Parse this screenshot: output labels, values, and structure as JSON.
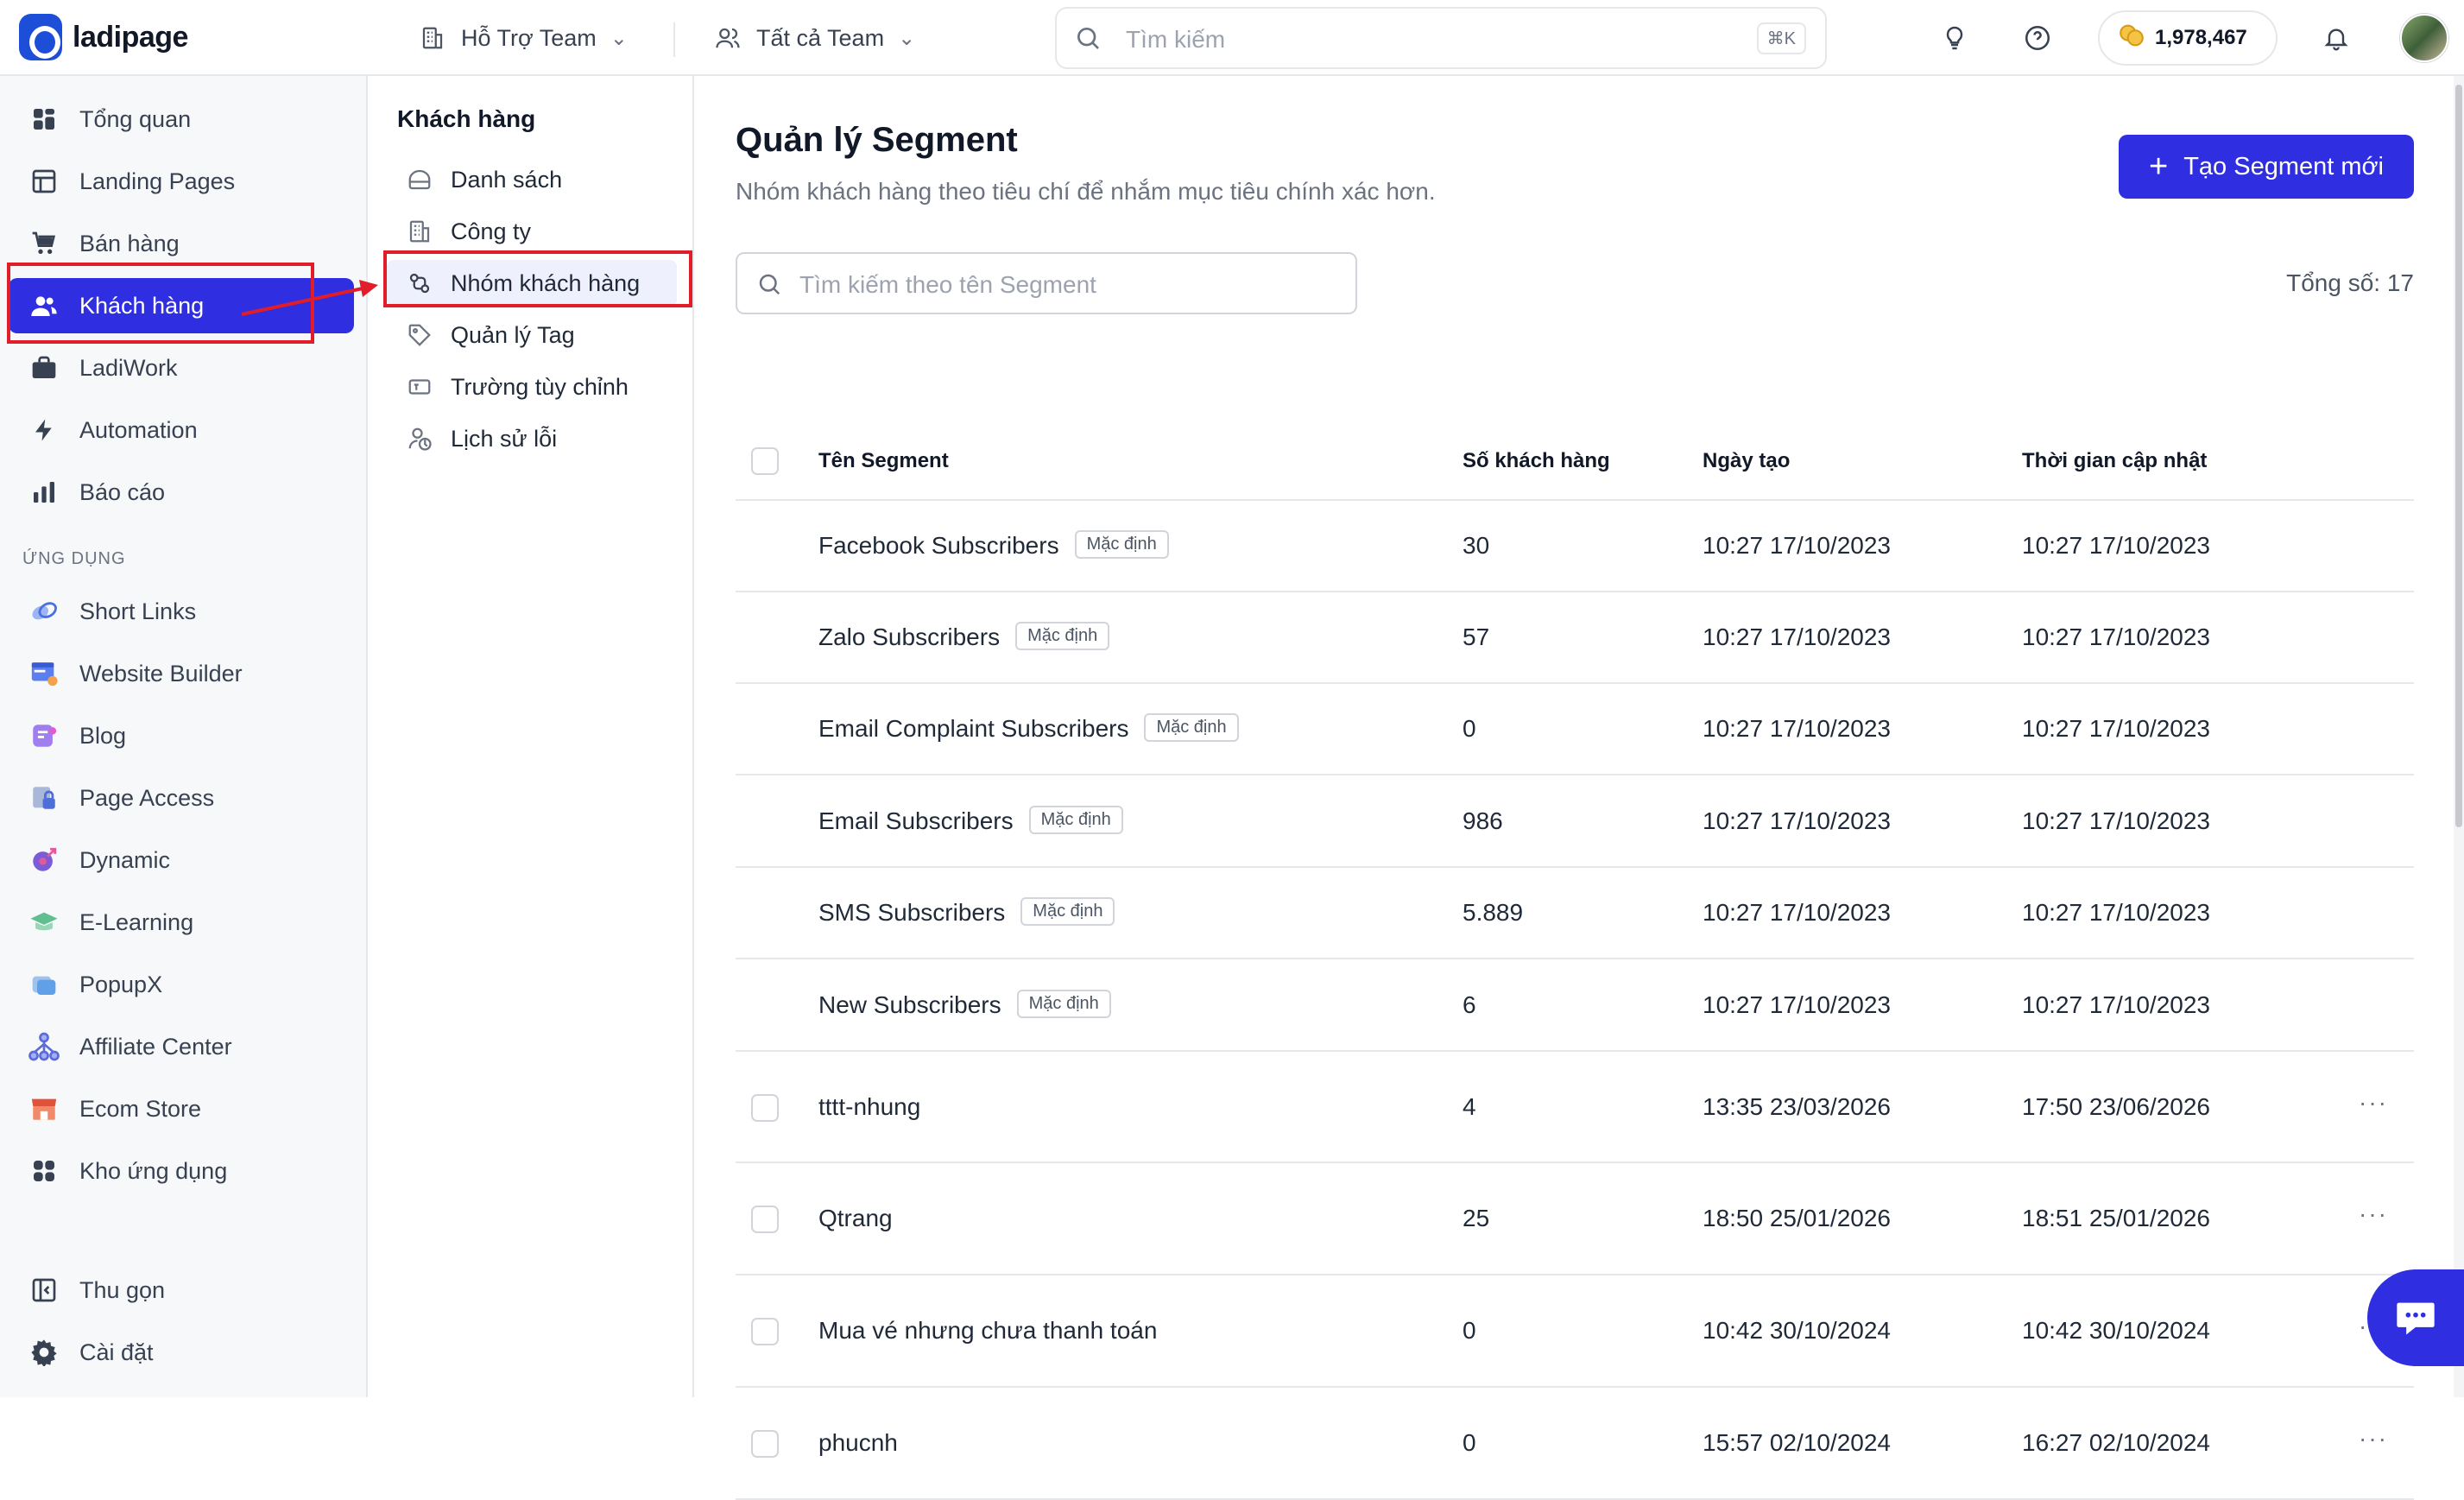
{
  "brand": {
    "name": "ladipage",
    "color": "#2f2ee0"
  },
  "topbar": {
    "team_label": "Hỗ Trợ Team",
    "all_team_label": "Tất cả Team",
    "search_placeholder": "Tìm kiếm",
    "search_shortcut": "⌘K",
    "credits": "1,978,467"
  },
  "sidebar": {
    "items": [
      {
        "label": "Tổng quan",
        "icon": "dashboard-icon"
      },
      {
        "label": "Landing Pages",
        "icon": "layout-icon"
      },
      {
        "label": "Bán hàng",
        "icon": "cart-icon"
      },
      {
        "label": "Khách hàng",
        "icon": "users-icon",
        "active": true
      },
      {
        "label": "LadiWork",
        "icon": "briefcase-icon"
      },
      {
        "label": "Automation",
        "icon": "bolt-icon"
      },
      {
        "label": "Báo cáo",
        "icon": "bar-chart-icon"
      }
    ],
    "apps_section": "ỨNG DỤNG",
    "apps": [
      {
        "label": "Short Links",
        "icon": "link-icon"
      },
      {
        "label": "Website Builder",
        "icon": "website-icon"
      },
      {
        "label": "Blog",
        "icon": "blog-icon"
      },
      {
        "label": "Page Access",
        "icon": "lock-icon"
      },
      {
        "label": "Dynamic",
        "icon": "dynamic-icon"
      },
      {
        "label": "E-Learning",
        "icon": "graduation-cap-icon"
      },
      {
        "label": "PopupX",
        "icon": "popup-icon"
      },
      {
        "label": "Affiliate Center",
        "icon": "affiliate-icon"
      },
      {
        "label": "Ecom Store",
        "icon": "store-icon"
      },
      {
        "label": "Kho ứng dụng",
        "icon": "apps-grid-icon"
      }
    ],
    "collapse_label": "Thu gọn",
    "settings_label": "Cài đặt"
  },
  "subnav": {
    "title": "Khách hàng",
    "items": [
      {
        "label": "Danh sách",
        "icon": "list-icon"
      },
      {
        "label": "Công ty",
        "icon": "building-icon"
      },
      {
        "label": "Nhóm khách hàng",
        "icon": "group-icon",
        "active": true
      },
      {
        "label": "Quản lý Tag",
        "icon": "tag-icon"
      },
      {
        "label": "Trường tùy chỉnh",
        "icon": "custom-field-icon"
      },
      {
        "label": "Lịch sử lỗi",
        "icon": "error-log-icon"
      }
    ]
  },
  "main": {
    "title": "Quản lý Segment",
    "subtitle": "Nhóm khách hàng theo tiêu chí để nhắm mục tiêu chính xác hơn.",
    "create_button": "Tạo Segment mới",
    "search_placeholder": "Tìm kiếm theo tên Segment",
    "total": "Tổng số: 17",
    "columns": [
      "Tên Segment",
      "Số khách hàng",
      "Ngày tạo",
      "Thời gian cập nhật"
    ],
    "default_badge": "Mặc định",
    "rows": [
      {
        "name": "Facebook Subscribers",
        "count": "30",
        "created": "10:27 17/10/2023",
        "updated": "10:27 17/10/2023",
        "default": true
      },
      {
        "name": "Zalo Subscribers",
        "count": "57",
        "created": "10:27 17/10/2023",
        "updated": "10:27 17/10/2023",
        "default": true
      },
      {
        "name": "Email Complaint Subscribers",
        "count": "0",
        "created": "10:27 17/10/2023",
        "updated": "10:27 17/10/2023",
        "default": true
      },
      {
        "name": "Email Subscribers",
        "count": "986",
        "created": "10:27 17/10/2023",
        "updated": "10:27 17/10/2023",
        "default": true
      },
      {
        "name": "SMS Subscribers",
        "count": "5.889",
        "created": "10:27 17/10/2023",
        "updated": "10:27 17/10/2023",
        "default": true
      },
      {
        "name": "New Subscribers",
        "count": "6",
        "created": "10:27 17/10/2023",
        "updated": "10:27 17/10/2023",
        "default": true
      },
      {
        "name": "tttt-nhung",
        "count": "4",
        "created": "13:35 23/03/2026",
        "updated": "17:50 23/06/2026",
        "default": false
      },
      {
        "name": "Qtrang",
        "count": "25",
        "created": "18:50 25/01/2026",
        "updated": "18:51 25/01/2026",
        "default": false
      },
      {
        "name": "Mua vé nhưng chưa thanh toán",
        "count": "0",
        "created": "10:42 30/10/2024",
        "updated": "10:42 30/10/2024",
        "default": false
      },
      {
        "name": "phucnh",
        "count": "0",
        "created": "15:57 02/10/2024",
        "updated": "16:27 02/10/2024",
        "default": false
      }
    ],
    "more_icon": "···"
  },
  "annotation_color": "#e11d2a"
}
